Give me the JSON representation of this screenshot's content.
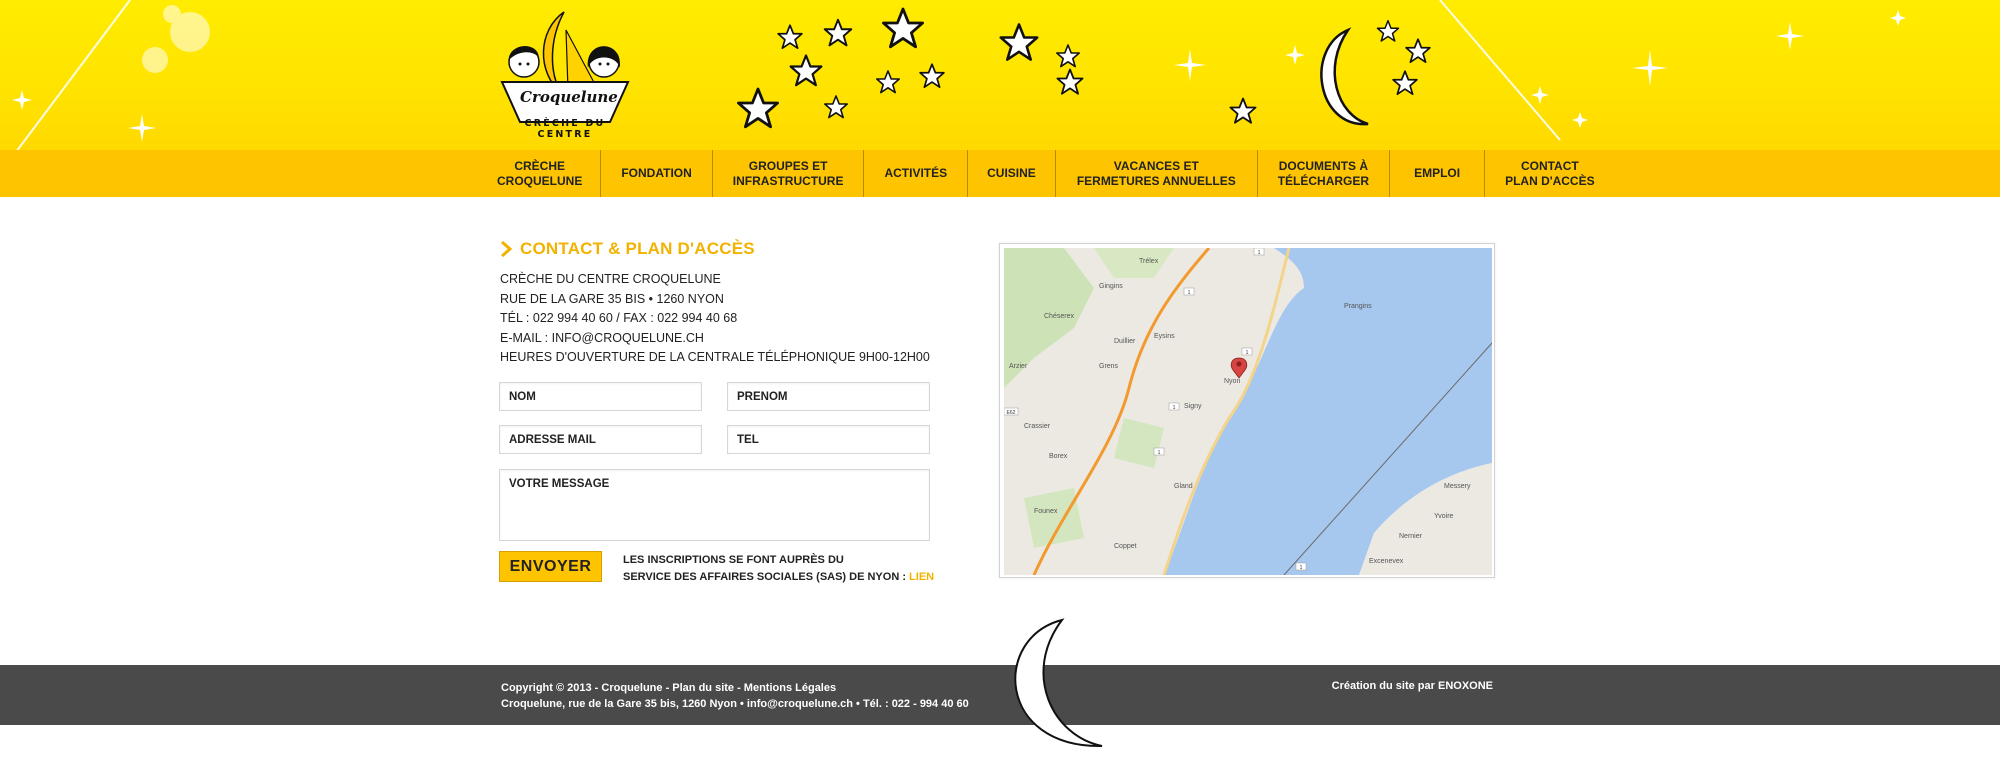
{
  "logo": {
    "title": "Croquelune",
    "subtitle": "CRÈCHE DU CENTRE"
  },
  "nav": {
    "items": [
      {
        "label": "CRÈCHE\nCROQUELUNE"
      },
      {
        "label": "FONDATION"
      },
      {
        "label": "GROUPES ET\nINFRASTRUCTURE"
      },
      {
        "label": "ACTIVITÉS"
      },
      {
        "label": "CUISINE"
      },
      {
        "label": "VACANCES ET\nFERMETURES ANNUELLES"
      },
      {
        "label": "DOCUMENTS À\nTÉLÉCHARGER"
      },
      {
        "label": "EMPLOI"
      },
      {
        "label": "CONTACT\nPLAN  D'ACCÈS"
      }
    ]
  },
  "content": {
    "title": "CONTACT & PLAN D'ACCÈS",
    "address": [
      "CRÈCHE DU CENTRE CROQUELUNE",
      "RUE DE LA GARE 35 BIS • 1260 NYON",
      "TÉL : 022 994 40 60  /  FAX : 022 994 40 68",
      "E-MAIL : INFO@CROQUELUNE.CH",
      "HEURES D'OUVERTURE DE LA CENTRALE TÉLÉPHONIQUE 9H00-12H00"
    ]
  },
  "form": {
    "nom_placeholder": "NOM",
    "prenom_placeholder": "PRÉNOM",
    "email_placeholder": "ADRESSE MAIL",
    "tel_placeholder": "TÉL",
    "message_placeholder": "VOTRE MESSAGE",
    "send_label": "ENVOYER",
    "inscriptions_line1": "LES INSCRIPTIONS SE FONT AUPRÈS DU",
    "inscriptions_line2": "SERVICE DES AFFAIRES SOCIALES (SAS) DE NYON : ",
    "link_label": "LIEN"
  },
  "map": {
    "place_label": "Nyon",
    "road_labels": [
      "1",
      "1",
      "1",
      "1",
      "1",
      "1",
      "E62"
    ],
    "place_labels": [
      "Prangins",
      "Eysins",
      "Signy",
      "Duillier",
      "Trélex",
      "Gingins",
      "Chéserex",
      "Grens",
      "Crassier",
      "Borex",
      "Arzier",
      "Gland",
      "Coppet",
      "Founex",
      "Yvoire",
      "Messery",
      "Nernier",
      "Excenevex"
    ]
  },
  "footer": {
    "line1": "Copyright © 2013 - Croquelune - Plan du site - Mentions Légales",
    "line2": "Croquelune, rue de la Gare 35 bis, 1260 Nyon • info@croquelune.ch • Tél. : 022 - 994 40 60",
    "credit": "Création du site par ENOXONE"
  },
  "colors": {
    "yellow": "#ffe600",
    "nav": "#ffc400",
    "accent": "#f2b200",
    "footer": "#4a4a4a"
  }
}
